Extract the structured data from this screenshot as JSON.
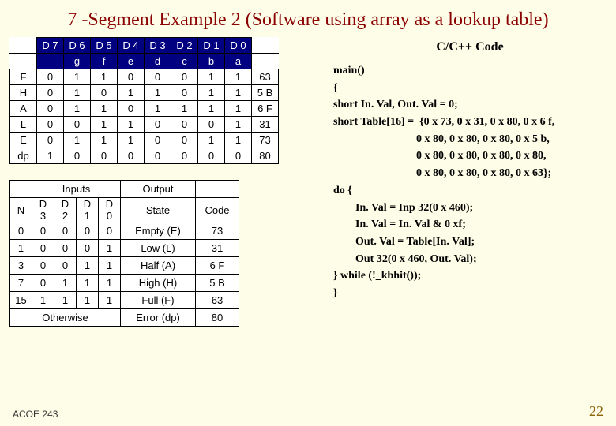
{
  "title": "7 -Segment Example 2 (Software using array as a lookup table)",
  "footer": {
    "left": "ACOE 243",
    "right": "22"
  },
  "seg_table": {
    "header1": [
      "",
      "D 7",
      "D 6",
      "D 5",
      "D 4",
      "D 3",
      "D 2",
      "D 1",
      "D 0",
      ""
    ],
    "header2": [
      "",
      "-",
      "g",
      "f",
      "e",
      "d",
      "c",
      "b",
      "a",
      ""
    ],
    "rows": [
      [
        "F",
        "0",
        "1",
        "1",
        "0",
        "0",
        "0",
        "1",
        "1",
        "63"
      ],
      [
        "H",
        "0",
        "1",
        "0",
        "1",
        "1",
        "0",
        "1",
        "1",
        "5 B"
      ],
      [
        "A",
        "0",
        "1",
        "1",
        "0",
        "1",
        "1",
        "1",
        "1",
        "6 F"
      ],
      [
        "L",
        "0",
        "0",
        "1",
        "1",
        "0",
        "0",
        "0",
        "1",
        "31"
      ],
      [
        "E",
        "0",
        "1",
        "1",
        "1",
        "0",
        "0",
        "1",
        "1",
        "73"
      ],
      [
        "dp",
        "1",
        "0",
        "0",
        "0",
        "0",
        "0",
        "0",
        "0",
        "80"
      ]
    ]
  },
  "io_table": {
    "h1": {
      "inputs": "Inputs",
      "output": "Output"
    },
    "h2": [
      "N",
      "D 3",
      "D 2",
      "D 1",
      "D 0",
      "State",
      "Code"
    ],
    "rows": [
      [
        "0",
        "0",
        "0",
        "0",
        "0",
        "Empty (E)",
        "73"
      ],
      [
        "1",
        "0",
        "0",
        "0",
        "1",
        "Low (L)",
        "31"
      ],
      [
        "3",
        "0",
        "0",
        "1",
        "1",
        "Half (A)",
        "6 F"
      ],
      [
        "7",
        "0",
        "1",
        "1",
        "1",
        "High (H)",
        "5 B"
      ],
      [
        "15",
        "1",
        "1",
        "1",
        "1",
        "Full (F)",
        "63"
      ]
    ],
    "otherwise": {
      "label": "Otherwise",
      "state": "Error (dp)",
      "code": "80"
    }
  },
  "code": {
    "title": "C/C++ Code",
    "l1": "main()",
    "l2": "{",
    "l3": "short In. Val, Out. Val = 0;",
    "l4": "short Table[16] =  {0 x 73, 0 x 31, 0 x 80, 0 x 6 f,",
    "l5": "                              0 x 80, 0 x 80, 0 x 80, 0 x 5 b,",
    "l6": "                              0 x 80, 0 x 80, 0 x 80, 0 x 80,",
    "l7": "                              0 x 80, 0 x 80, 0 x 80, 0 x 63};",
    "l8": "do {",
    "l9": "        In. Val = Inp 32(0 x 460);",
    "l10": "        In. Val = In. Val & 0 xf;",
    "l11": "        Out. Val = Table[In. Val];",
    "l12": "        Out 32(0 x 460, Out. Val);",
    "l13": "} while (!_kbhit());",
    "l14": "}"
  }
}
